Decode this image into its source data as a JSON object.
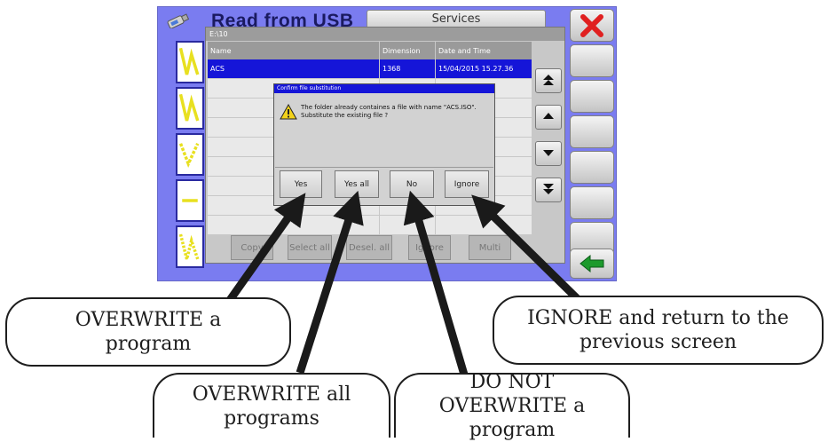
{
  "screen": {
    "title": "Read from USB",
    "top_tab": "Services"
  },
  "file_window": {
    "path": "E:\\10",
    "columns": [
      "Name",
      "Dimension",
      "Date and Time"
    ],
    "rows": [
      {
        "name": "ACS",
        "dimension": "1368",
        "date": "15/04/2015 15.27.36",
        "selected": true
      }
    ],
    "bottom_buttons": [
      "Copy",
      "Select all",
      "Desel. all",
      "Ignore",
      "Multi"
    ]
  },
  "confirm_dialog": {
    "title": "Confirm file substitution",
    "message": "The folder already containes a file with name \"ACS.ISO\". Substitute the existing file ?",
    "buttons": {
      "yes": "Yes",
      "yes_all": "Yes all",
      "no": "No",
      "ignore": "Ignore"
    }
  },
  "callouts": {
    "overwrite": "OVERWRITE a program",
    "overwrite_all": "OVERWRITE all programs",
    "do_not_overwrite": "DO NOT OVERWRITE a program",
    "ignore": "IGNORE and return to the previous screen"
  },
  "colors": {
    "screen_bg": "#7a7cf0",
    "selection": "#1515d8",
    "close_red": "#e02020",
    "back_green": "#1c9a2c"
  },
  "icons": [
    "usb-icon",
    "close-icon",
    "back-arrow-icon",
    "warning-icon",
    "page-up-icon",
    "scroll-up-icon",
    "scroll-down-icon",
    "page-down-icon"
  ]
}
